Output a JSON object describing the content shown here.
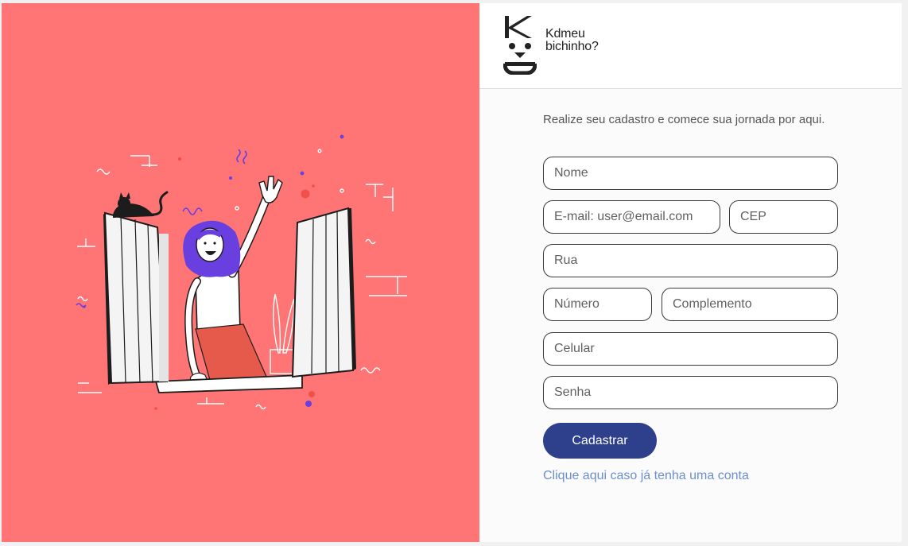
{
  "brand": {
    "line1": "Kdmeu",
    "line2": "bichinho?"
  },
  "form": {
    "intro": "Realize seu cadastro e comece sua jornada por aqui.",
    "name_placeholder": "Nome",
    "email_placeholder": "E-mail: user@email.com",
    "cep_placeholder": "CEP",
    "street_placeholder": "Rua",
    "number_placeholder": "Número",
    "complement_placeholder": "Complemento",
    "phone_placeholder": "Celular",
    "password_placeholder": "Senha",
    "submit_label": "Cadastrar",
    "login_link": "Clique aqui caso já tenha uma conta"
  },
  "colors": {
    "hero_background": "#ff7575",
    "primary_button": "#2e3f8c",
    "link": "#6c8fd0",
    "hair": "#6a3fe0"
  },
  "icons": {
    "hero": "woman-waving-from-window-illustration",
    "logo": "dog-face-logo"
  }
}
